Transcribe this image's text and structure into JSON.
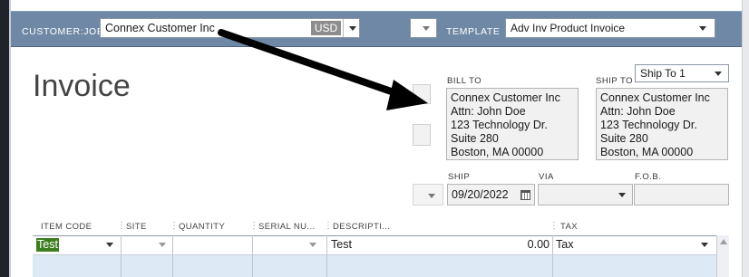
{
  "header": {
    "customer_label": "CUSTOMER:JOB",
    "customer_value": "Connex Customer Inc",
    "currency": "USD",
    "template_label": "TEMPLATE",
    "template_value": "Adv Inv Product Invoice"
  },
  "form": {
    "title": "Invoice",
    "bill_to_label": "BILL TO",
    "ship_to_label": "SHIP TO",
    "ship_to_selected": "Ship To 1",
    "bill_to_lines": [
      "Connex Customer Inc",
      "Attn: John Doe",
      "123 Technology Dr.",
      "Suite 280",
      "Boston, MA 00000"
    ],
    "ship_to_lines": [
      "Connex Customer Inc",
      "Attn: John Doe",
      "123 Technology Dr.",
      "Suite 280",
      "Boston, MA 00000"
    ],
    "ship_label": "SHIP",
    "ship_date": "09/20/2022",
    "via_label": "VIA",
    "fob_label": "F.O.B."
  },
  "table": {
    "columns": [
      "ITEM CODE",
      "SITE",
      "QUANTITY",
      "SERIAL NU...",
      "DESCRIPTI...",
      "TAX"
    ],
    "row": {
      "item_code": "Test",
      "description": "Test",
      "amount": "0.00",
      "tax": "Tax"
    }
  },
  "colors": {
    "header_bar": "#6f88a6",
    "table_fill": "#dde9f5",
    "item_highlight": "#3c7d1f"
  },
  "icons": [
    "chevron-down-icon",
    "calendar-icon",
    "scroll-up-icon",
    "annotation-arrow"
  ]
}
